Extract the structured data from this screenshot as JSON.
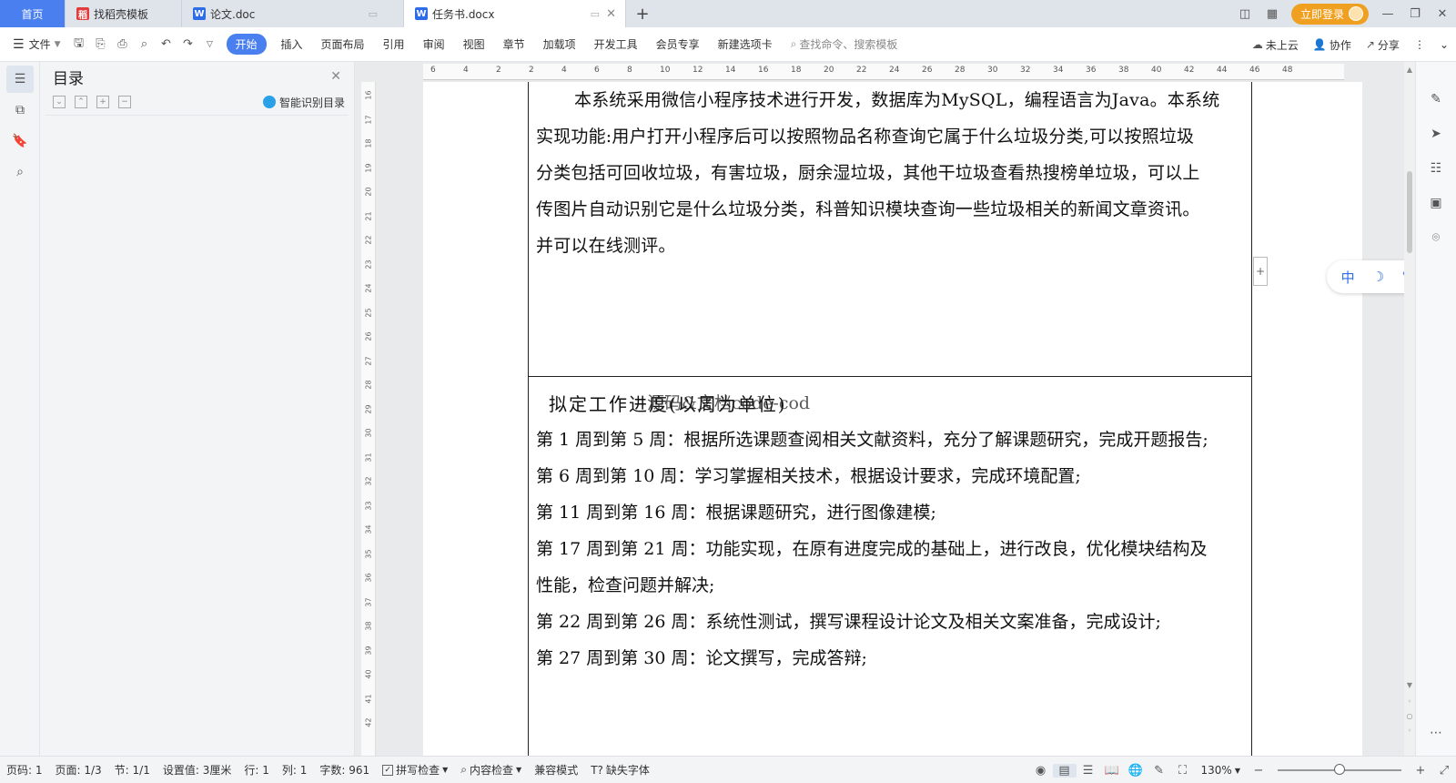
{
  "tabs": {
    "home": "首页",
    "items": [
      {
        "label": "找稻壳模板",
        "icon": "docer-icon"
      },
      {
        "label": "论文.doc",
        "icon": "word-doc-icon"
      },
      {
        "label": "任务书.docx",
        "icon": "word-doc-icon",
        "active": true
      }
    ],
    "new_tab": "+",
    "login": "立即登录"
  },
  "menubar": {
    "file": "文件",
    "items": [
      "开始",
      "插入",
      "页面布局",
      "引用",
      "审阅",
      "视图",
      "章节",
      "加载项",
      "开发工具",
      "会员专享",
      "新建选项卡"
    ],
    "active": "开始",
    "search_placeholder": "查找命令、搜索模板",
    "right": [
      "未上云",
      "协作",
      "分享"
    ]
  },
  "toc": {
    "title": "目录",
    "smart": "智能识别目录"
  },
  "ruler": {
    "h_ticks": [
      "6",
      "4",
      "2",
      "2",
      "4",
      "6",
      "8",
      "10",
      "12",
      "14",
      "16",
      "18",
      "20",
      "22",
      "24",
      "26",
      "28",
      "30",
      "32",
      "34",
      "36",
      "38",
      "40",
      "42",
      "44",
      "46",
      "48"
    ],
    "v_ticks": [
      "16",
      "17",
      "18",
      "19",
      "20",
      "21",
      "22",
      "23",
      "24",
      "25",
      "26",
      "27",
      "28",
      "29",
      "30",
      "31",
      "32",
      "33",
      "34",
      "35",
      "36",
      "37",
      "38",
      "39",
      "40",
      "41",
      "42"
    ]
  },
  "document": {
    "intro_lines": [
      "本系统采用微信小程序技术进行开发，数据库为MySQL，编程语言为Java。本系统",
      "实现功能:用户打开小程序后可以按照物品名称查询它属于什么垃圾分类,可以按照垃圾",
      "分类包括可回收垃圾，有害垃圾，厨余湿垃圾，其他干垃圾查看热搜榜单垃圾，可以上",
      "传图片自动识别它是什么垃圾分类，科普知识模块查询一些垃圾相关的新闻文章资讯。",
      "并可以在线测评。"
    ],
    "schedule_heading": "拟定工作进度(以周为单位)",
    "schedule_overlay": "源码&文档code-cod",
    "schedule_lines": [
      "第 1 周到第 5 周：根据所选课题查阅相关文献资料，充分了解课题研究，完成开题报告;",
      "第 6 周到第 10 周：学习掌握相关技术，根据设计要求，完成环境配置;",
      "第 11 周到第 16 周：根据课题研究，进行图像建模;",
      "第 17 周到第 21 周：功能实现，在原有进度完成的基础上，进行改良，优化模块结构及",
      "性能，检查问题并解决;",
      "第 22 周到第 26 周：系统性测试，撰写课程设计论文及相关文案准备，完成设计;",
      "第 27 周到第 30 周：论文撰写，完成答辩;"
    ]
  },
  "ime": {
    "lang": "中",
    "moon": "☽",
    "punct": "°,",
    "arrow": "❯"
  },
  "statusbar": {
    "page_code": "页码: 1",
    "page": "页面: 1/3",
    "section": "节: 1/1",
    "setting": "设置值: 3厘米",
    "row": "行: 1",
    "col": "列: 1",
    "words": "字数: 961",
    "spell": "拼写检查",
    "content": "内容检查",
    "compat": "兼容模式",
    "missing_font": "缺失字体",
    "zoom": "130%",
    "zoom_level": 0.5
  },
  "colors": {
    "accent": "#4a7ff0",
    "login": "#f0a020"
  }
}
